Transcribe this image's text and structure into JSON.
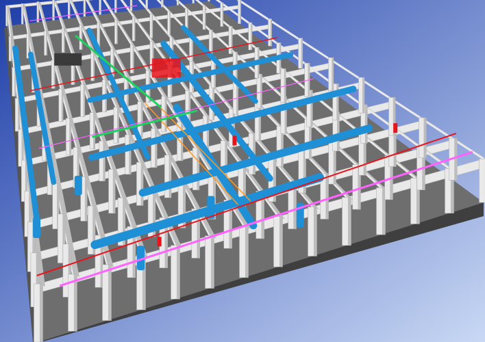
{
  "viewport": {
    "view": "isometric-3d",
    "background_top": "#1e3ea8",
    "background_bottom": "#c9d8f4"
  },
  "model": {
    "floor_color": "#6e6e6e",
    "slab_edge_color": "#3f3f3f",
    "structure_color": "#e9e9e9",
    "structure_shade": "#bdbdbd",
    "grid": {
      "cols": 13,
      "rows": 9
    },
    "systems": [
      {
        "id": "hvac-ducts",
        "color": "#1f8fd6"
      },
      {
        "id": "fire-sprinkler",
        "color": "#e8141b"
      },
      {
        "id": "electrical",
        "color": "#ff62ff"
      },
      {
        "id": "plumbing",
        "color": "#ff9a1e"
      },
      {
        "id": "chilled-water",
        "color": "#20d060"
      },
      {
        "id": "mech-room",
        "color": "#3a3a3a"
      }
    ]
  }
}
